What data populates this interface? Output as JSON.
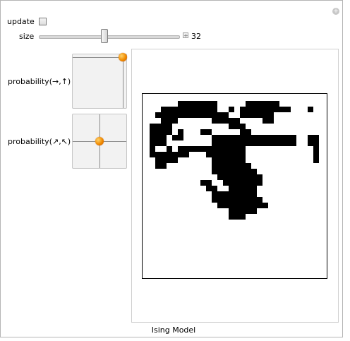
{
  "controls": {
    "update_label": "update",
    "update_checked": false,
    "size_label": "size",
    "size_value": "32",
    "size_slider_fraction": 0.47,
    "prob1_label": "probability(→,↑)",
    "prob1_point": [
      0.93,
      0.05
    ],
    "prob2_label": "probability(↗,↖)",
    "prob2_point": [
      0.5,
      0.5
    ]
  },
  "caption": "Ising Model",
  "lattice": {
    "size": 32,
    "black_color": "#000000",
    "white_color": "#ffffff",
    "rows": [
      "00000000000000000000000000000000",
      "00000011111110000011111100000000",
      "00011111111110010111111111000100",
      "00111111111111100111111000000000",
      "00011100000011111000011000000000",
      "01111000000000011100000000000000",
      "01111010001100000110000000000000",
      "01110110000011111111111111100110",
      "01110000000011111111111111100110",
      "01001011111111111100000000000010",
      "01111111000111111100000000000010",
      "00111100000011111100000000000010",
      "00110000000011111110000000000000",
      "00000000000011111111000000000000",
      "00000000000001111111100000000000",
      "00000000001100111111100000000000",
      "00000000000110011111000000000000",
      "00000000000011111111000000000000",
      "00000000000011111111100000000000",
      "00000000000001111111110000000000",
      "00000000000000011111000000000000",
      "00000000000000011100000000000000",
      "00000000000000000000000000000000",
      "00000000000000000000000000000000",
      "00000000000000000000000000000000",
      "00000000000000000000000000000000",
      "00000000000000000000000000000000",
      "00000000000000000000000000000000",
      "00000000000000000000000000000000",
      "00000000000000000000000000000000",
      "00000000000000000000000000000000",
      "00000000000000000000000000000000"
    ]
  }
}
